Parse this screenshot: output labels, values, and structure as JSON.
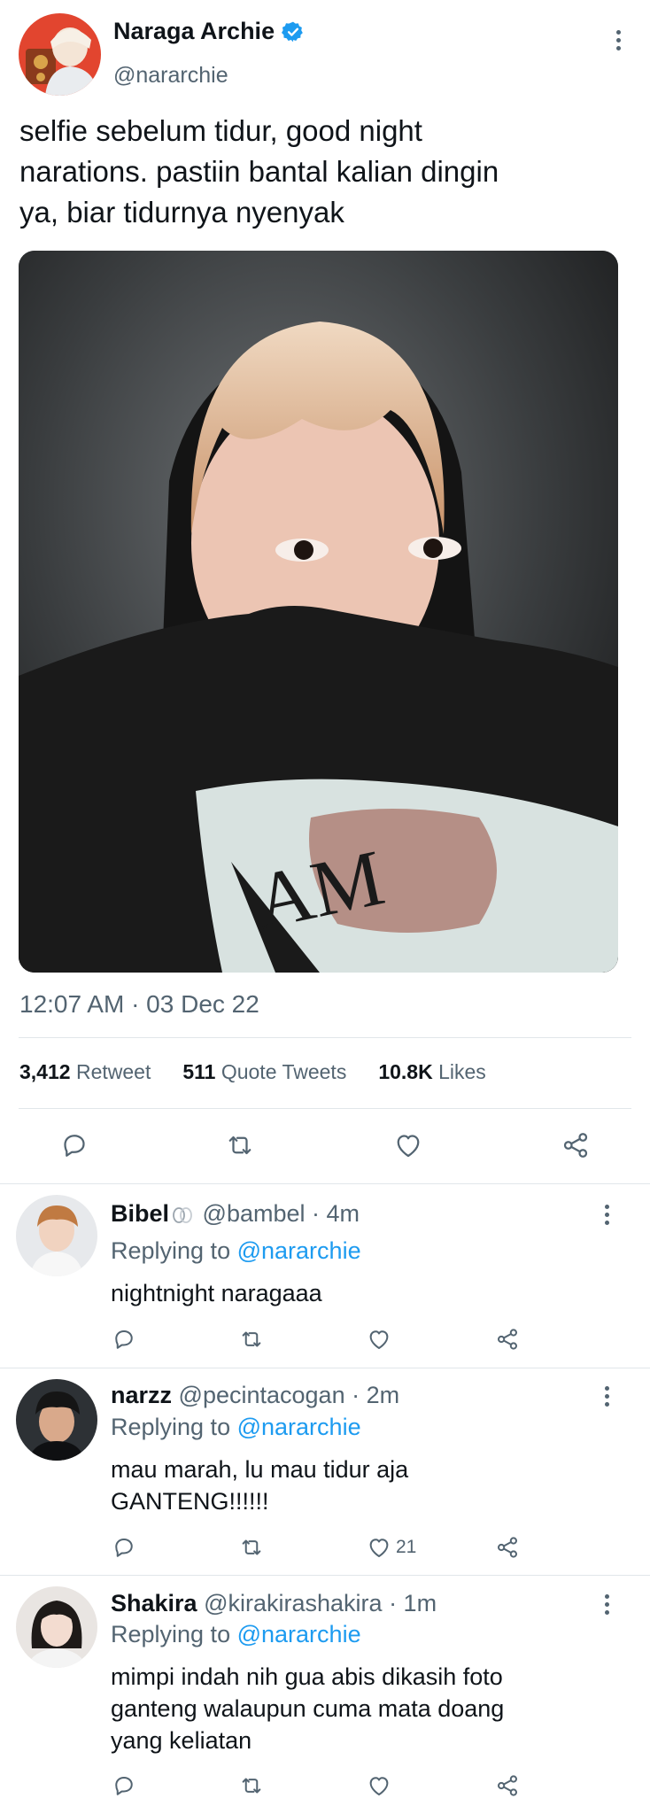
{
  "tweet": {
    "author_name": "Naraga Archie",
    "author_handle": "@nararchie",
    "verified": true,
    "text_lines": [
      "selfie sebelum tidur, good night",
      "narations. pastiin bantal kalian dingin",
      "ya, biar tidurnya nyenyak"
    ],
    "media_text": "AM",
    "timestamp": "12:07 AM · 03 Dec 22",
    "stats": {
      "retweets": "3,412",
      "retweets_label": "Retweet",
      "quotes": "511",
      "quotes_label": "Quote Tweets",
      "likes": "10.8K",
      "likes_label": "Likes"
    },
    "actions": [
      "reply-icon",
      "retweet-icon",
      "like-icon",
      "share-icon"
    ]
  },
  "replies": [
    {
      "name": "Bibel",
      "handle": "@bambel",
      "time": "· 4m",
      "replying_prefix": "Replying to",
      "replying_to": "@nararchie",
      "text_lines": [
        "nightnight naragaaa"
      ],
      "like_count": ""
    },
    {
      "name": "narzz",
      "handle": "@pecintacogan",
      "time": "· 2m",
      "replying_prefix": "Replying to",
      "replying_to": "@nararchie",
      "text_lines": [
        "mau marah, lu mau tidur aja",
        "GANTENG!!!!!!"
      ],
      "like_count": "21"
    },
    {
      "name": "Shakira",
      "handle": "@kirakirashakira",
      "time": "· 1m",
      "replying_prefix": "Replying to",
      "replying_to": "@nararchie",
      "text_lines": [
        "mimpi indah nih gua abis dikasih foto",
        "ganteng walaupun cuma mata doang",
        "yang keliatan"
      ],
      "like_count": ""
    }
  ],
  "colors": {
    "accent": "#1d9bf0",
    "text": "#0f1419",
    "muted": "#536471",
    "divider": "#e1e6ea"
  }
}
